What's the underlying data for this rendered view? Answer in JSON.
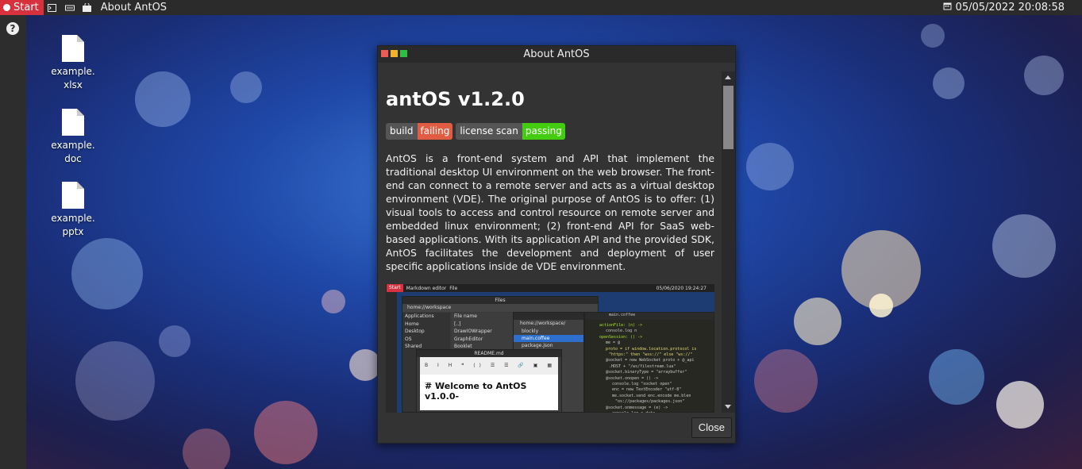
{
  "taskbar": {
    "start_label": "Start",
    "active_app": "About AntOS",
    "datetime": "05/05/2022 20:08:58"
  },
  "desktop": {
    "icons": [
      {
        "label": "example.xlsx"
      },
      {
        "label": "example.doc"
      },
      {
        "label": "example.pptx"
      }
    ]
  },
  "dialog": {
    "title": "About AntOS",
    "heading": "antOS v1.2.0",
    "badges": [
      {
        "key": "build",
        "value": "failing",
        "color": "#e05d44"
      },
      {
        "key": "license scan",
        "value": "passing",
        "color": "#4c1"
      }
    ],
    "description": "AntOS is a front-end system and API that implement the traditional desktop UI environment on the web browser. The front-end can connect to a remote server and acts as a virtual desktop environment (VDE). The original purpose of AntOS is to offer: (1) visual tools to access and control resource on remote server and embedded linux environment; (2) front-end API for SaaS web-based applications. With its application API and the provided SDK, AntOS facilitates the development and deployment of user specific applications inside de VDE environment.",
    "close_label": "Close",
    "preview": {
      "start": "Start",
      "menu1": "Markdown editor",
      "menu2": "File",
      "datetime": "05/06/2020 19:24:27",
      "files_title": "Files",
      "path": "home://workspace",
      "sidebar": [
        "Applications",
        "Home",
        "Desktop",
        "OS",
        "Shared"
      ],
      "col_header": "File name",
      "files": [
        "[..]",
        "DrawIOWrapper",
        "GraphEditor",
        "Booklet"
      ],
      "files2_path": "home://workspace/",
      "files2": [
        "blockly",
        "main.coffee",
        "package.json"
      ],
      "editor_tab": "main.coffee",
      "md_title": "README.md",
      "md_tools": "B I H ❝ ⟨⟩ ☰ ☰ 🔗 ▣ ▦ ―",
      "md_body": "# Welcome to AntOS v1.0.0-"
    }
  },
  "colors": {
    "close_red": "#ed5c54",
    "min_yellow": "#f0b52c",
    "max_green": "#2fc043",
    "start_red": "#d8313e"
  }
}
